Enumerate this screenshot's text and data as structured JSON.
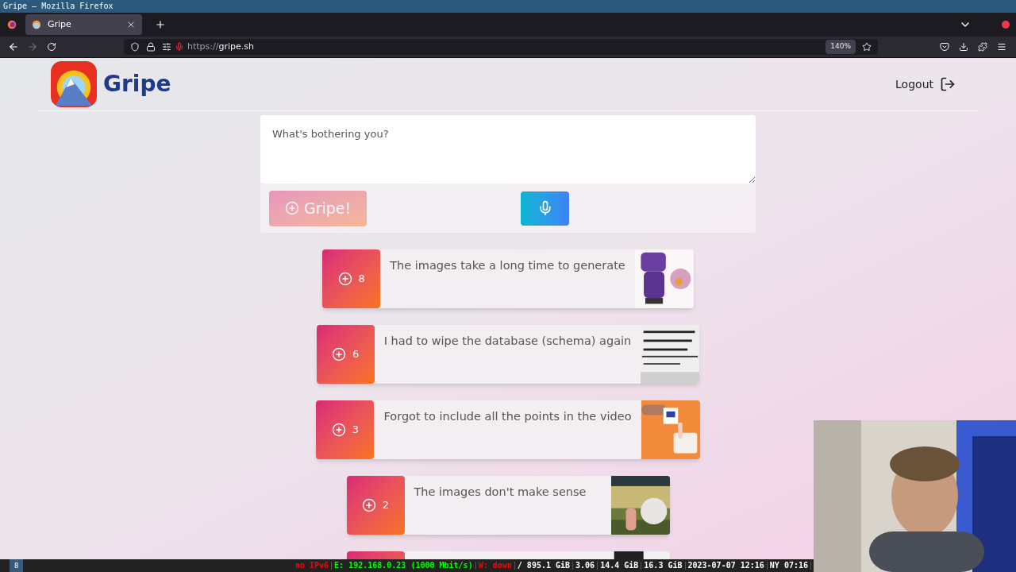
{
  "window": {
    "title": "Gripe — Mozilla Firefox"
  },
  "tabs": [
    {
      "label": "Gripe",
      "selected": true
    }
  ],
  "address_bar": {
    "url_scheme": "https://",
    "url_host": "gripe.sh",
    "zoom": "140%"
  },
  "header": {
    "brand": "Gripe",
    "logout": "Logout"
  },
  "composer": {
    "placeholder": "What's bothering you?",
    "submit": {
      "label": "Gripe!",
      "disabled": true
    }
  },
  "gripes": [
    {
      "votes": "8",
      "text": "The images take a long time to generate",
      "kind": "robot"
    },
    {
      "votes": "6",
      "text": "I had to wipe the database (schema) again",
      "kind": "whiteboard"
    },
    {
      "votes": "3",
      "text": "Forgot to include all the points in the video",
      "kind": "hand"
    },
    {
      "votes": "2",
      "text": "The images don't make sense",
      "kind": "field"
    },
    {
      "kind": "dark"
    }
  ],
  "status_bar": {
    "workspace": "8",
    "items": [
      {
        "text": "no IPv6",
        "color": "#ff0000"
      },
      {
        "text": "E: 192.168.0.23 (1000 Mbit/s)",
        "color": "#00ff00"
      },
      {
        "text": "W: down",
        "color": "#ff0000"
      },
      {
        "text": "/ 895.1 GiB",
        "color": "#ffffff"
      },
      {
        "text": "3.06",
        "color": "#ffffff"
      },
      {
        "text": "14.4 GiB",
        "color": "#ffffff"
      },
      {
        "text": "16.3 GiB",
        "color": "#ffffff"
      },
      {
        "text": "2023-07-07 12:16",
        "color": "#ffffff"
      },
      {
        "text": "NY 07:16",
        "color": "#ffffff"
      }
    ]
  }
}
